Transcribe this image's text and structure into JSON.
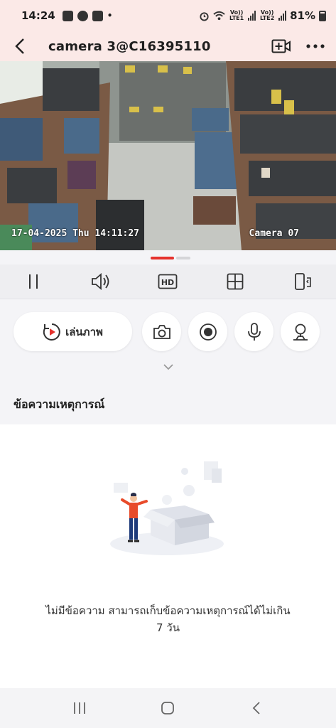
{
  "status_bar": {
    "time": "14:24",
    "sim1_label": "Vo)) LTE1",
    "sim2_label": "Vo)) LTE2",
    "battery": "81%",
    "notification_icons": [
      "gallery-icon",
      "facebook-icon",
      "sigma-app-icon",
      "dot-icon"
    ],
    "system_icons": [
      "alarm-icon",
      "wifi-icon",
      "signal-icon",
      "battery-icon"
    ]
  },
  "header": {
    "title": "camera 3@C16395110",
    "icons": [
      "back-arrow-icon",
      "add-camera-icon",
      "more-options-icon"
    ]
  },
  "video": {
    "timestamp": "17-04-2025 Thu 14:11:27",
    "camera_label": "Camera 07"
  },
  "controls": {
    "icons": [
      "pause-icon",
      "volume-icon",
      "hd-icon",
      "grid-layout-icon",
      "rotate-screen-icon"
    ],
    "hd_label": "HD"
  },
  "actions": {
    "playback_label": "เล่นภาพ",
    "buttons": [
      "snapshot-icon",
      "record-icon",
      "microphone-icon",
      "ptz-icon"
    ]
  },
  "events": {
    "section_title": "ข้อความเหตุการณ์",
    "empty_message_line1": "ไม่มีข้อความ สามารถเก็บข้อความเหตุการณ์ได้ไม่เกิน",
    "empty_message_line2": "7 วัน"
  },
  "colors": {
    "accent": "#e5322d",
    "header_bg": "#fbe9e7",
    "panel_bg": "#f4f4f7"
  },
  "nav_bar": {
    "icons": [
      "recent-apps-icon",
      "home-icon",
      "back-icon"
    ]
  }
}
